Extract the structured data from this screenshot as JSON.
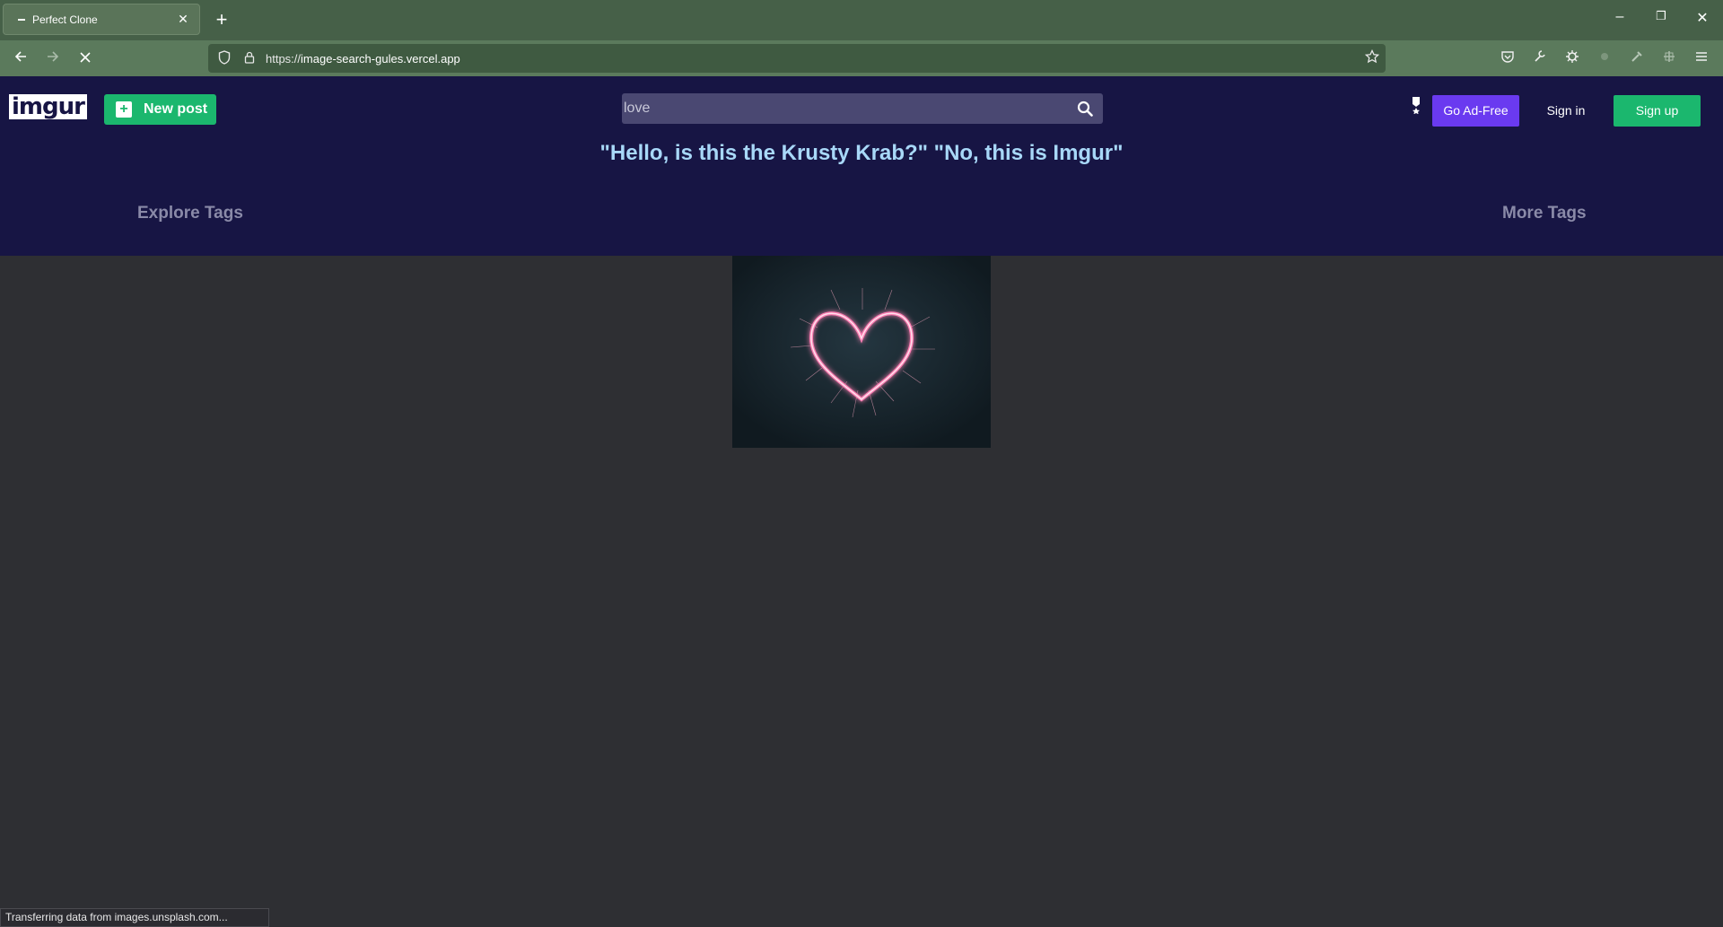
{
  "browser": {
    "tab_title": "Perfect Clone",
    "tab_close": "✕",
    "new_tab": "+",
    "url_scheme": "https://",
    "url_host": "image-search-gules.vercel.app",
    "window": {
      "minimize": "–",
      "restore": "❐",
      "close": "✕"
    }
  },
  "header": {
    "logo": "imgur",
    "new_post_label": "New post",
    "search_value": "love",
    "go_ad_free_label": "Go Ad-Free",
    "sign_in_label": "Sign in",
    "sign_up_label": "Sign up",
    "tagline": "\"Hello, is this the Krusty Krab?\" \"No, this is Imgur\"",
    "explore_tags_label": "Explore Tags",
    "more_tags_label": "More Tags"
  },
  "gallery": {
    "items": [
      {
        "alt": "Heart shape drawn with a sparkler"
      }
    ]
  },
  "status_bar": {
    "text": "Transferring data from images.unsplash.com..."
  },
  "colors": {
    "header_bg": "#171544",
    "page_bg": "#2e2f33",
    "green": "#1bb76e",
    "purple": "#6a3af0",
    "tagline": "#a8d8f8"
  }
}
